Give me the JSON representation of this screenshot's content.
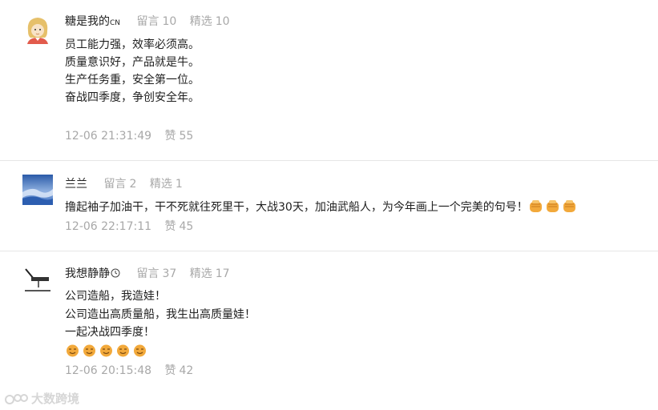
{
  "comments": [
    {
      "nickname": "糖是我的",
      "nickname_suffix": "CN",
      "comments_label": "留言",
      "comments_count": "10",
      "picks_label": "精选",
      "picks_count": "10",
      "lines": [
        "员工能力强，效率必须高。",
        "质量意识好，产品就是牛。",
        "生产任务重，安全第一位。",
        "奋战四季度，争创安全年。"
      ],
      "time": "12-06 21:31:49",
      "like_label": "赞",
      "like_count": "55"
    },
    {
      "nickname": "兰兰",
      "comments_label": "留言",
      "comments_count": "2",
      "picks_label": "精选",
      "picks_count": "1",
      "lines": [
        "撸起袖子加油干，干不死就往死里干，大战30天，加油武船人，为今年画上一个完美的句号！"
      ],
      "emoji": [
        "fist-emoji",
        "fist-emoji",
        "fist-emoji"
      ],
      "time": "12-06 22:17:11",
      "like_label": "赞",
      "like_count": "45"
    },
    {
      "nickname": "我想静静",
      "comments_label": "留言",
      "comments_count": "37",
      "picks_label": "精选",
      "picks_count": "17",
      "lines": [
        "公司造船，我造娃！",
        "公司造出高质量船，我生出高质量娃！",
        "一起决战四季度！"
      ],
      "emoji": [
        "smirk-emoji",
        "smirk-emoji",
        "smirk-emoji",
        "smirk-emoji",
        "smirk-emoji"
      ],
      "time": "12-06 20:15:48",
      "like_label": "赞",
      "like_count": "42"
    }
  ],
  "watermark": "大数跨境",
  "colors": {
    "meta": "#a8a8a8",
    "text": "#1e1e1e",
    "divider": "#e6e6e6",
    "emoji": "#f2a93b"
  }
}
